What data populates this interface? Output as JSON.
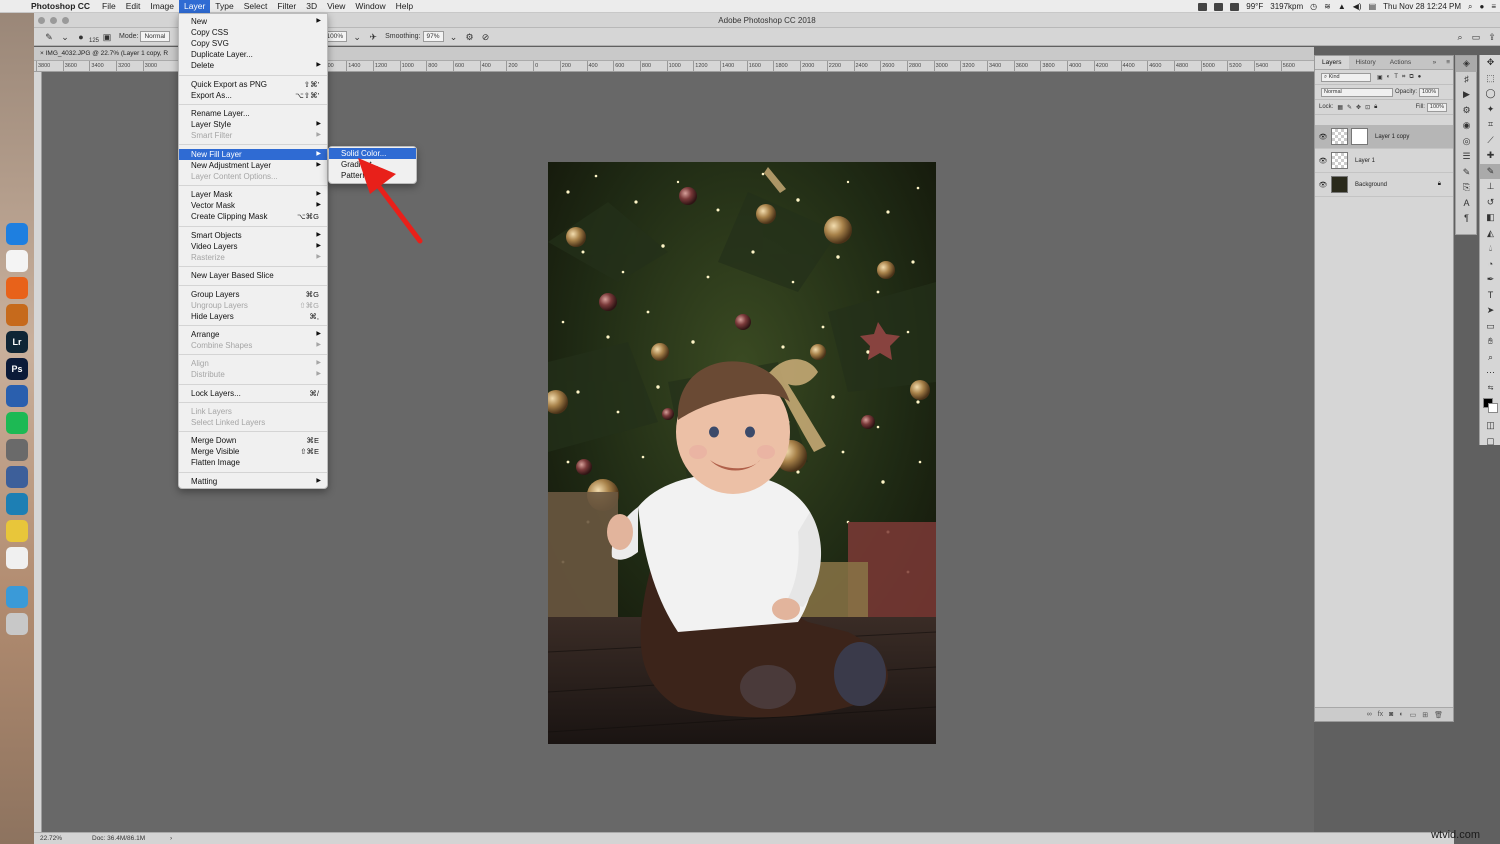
{
  "menubar": {
    "app_name": "Photoshop CC",
    "items": [
      "File",
      "Edit",
      "Image",
      "Layer",
      "Type",
      "Select",
      "Filter",
      "3D",
      "View",
      "Window",
      "Help"
    ],
    "active_item": "Layer",
    "clock": "Thu Nov 28  12:24 PM",
    "temperature": "99°F",
    "network_speed": "3197kpm"
  },
  "window": {
    "title": "Adobe Photoshop CC 2018",
    "doc_tab": "IMG_4032.JPG @ 22.7% (Layer 1 copy, R"
  },
  "options_bar": {
    "brush_size": "125",
    "mode_label": "Mode:",
    "mode_value": "Normal",
    "opacity_value": "100%",
    "smoothing_label": "Smoothing:",
    "smoothing_value": "97%"
  },
  "ruler": {
    "labels": [
      "3800",
      "3600",
      "3400",
      "3200",
      "3000",
      "1600",
      "1400",
      "1200",
      "1000",
      "800",
      "600",
      "400",
      "200",
      "0",
      "200",
      "400",
      "600",
      "800",
      "1000",
      "1200",
      "1400",
      "1600",
      "1800",
      "2000",
      "2200",
      "2400",
      "2600",
      "2800",
      "3000",
      "3200",
      "3400",
      "3600",
      "3800",
      "4000",
      "4200",
      "4400",
      "4600",
      "4800",
      "5000",
      "5200",
      "5400",
      "5600"
    ]
  },
  "layer_menu": {
    "items": [
      {
        "label": "New",
        "shortcut": "",
        "submenu": true,
        "disabled": false
      },
      {
        "label": "Copy CSS",
        "shortcut": "",
        "submenu": false,
        "disabled": false
      },
      {
        "label": "Copy SVG",
        "shortcut": "",
        "submenu": false,
        "disabled": false
      },
      {
        "label": "Duplicate Layer...",
        "shortcut": "",
        "submenu": false,
        "disabled": false
      },
      {
        "label": "Delete",
        "shortcut": "",
        "submenu": true,
        "disabled": false
      },
      {
        "label": "Quick Export as PNG",
        "shortcut": "⇧⌘'",
        "submenu": false,
        "disabled": false
      },
      {
        "label": "Export As...",
        "shortcut": "⌥⇧⌘'",
        "submenu": false,
        "disabled": false
      },
      {
        "label": "Rename Layer...",
        "shortcut": "",
        "submenu": false,
        "disabled": false
      },
      {
        "label": "Layer Style",
        "shortcut": "",
        "submenu": true,
        "disabled": false
      },
      {
        "label": "Smart Filter",
        "shortcut": "",
        "submenu": true,
        "disabled": true
      },
      {
        "label": "New Fill Layer",
        "shortcut": "",
        "submenu": true,
        "disabled": false,
        "highlighted": true
      },
      {
        "label": "New Adjustment Layer",
        "shortcut": "",
        "submenu": true,
        "disabled": false
      },
      {
        "label": "Layer Content Options...",
        "shortcut": "",
        "submenu": false,
        "disabled": true
      },
      {
        "label": "Layer Mask",
        "shortcut": "",
        "submenu": true,
        "disabled": false
      },
      {
        "label": "Vector Mask",
        "shortcut": "",
        "submenu": true,
        "disabled": false
      },
      {
        "label": "Create Clipping Mask",
        "shortcut": "⌥⌘G",
        "submenu": false,
        "disabled": false
      },
      {
        "label": "Smart Objects",
        "shortcut": "",
        "submenu": true,
        "disabled": false
      },
      {
        "label": "Video Layers",
        "shortcut": "",
        "submenu": true,
        "disabled": false
      },
      {
        "label": "Rasterize",
        "shortcut": "",
        "submenu": true,
        "disabled": true
      },
      {
        "label": "New Layer Based Slice",
        "shortcut": "",
        "submenu": false,
        "disabled": false
      },
      {
        "label": "Group Layers",
        "shortcut": "⌘G",
        "submenu": false,
        "disabled": false
      },
      {
        "label": "Ungroup Layers",
        "shortcut": "⇧⌘G",
        "submenu": false,
        "disabled": true
      },
      {
        "label": "Hide Layers",
        "shortcut": "⌘,",
        "submenu": false,
        "disabled": false
      },
      {
        "label": "Arrange",
        "shortcut": "",
        "submenu": true,
        "disabled": false
      },
      {
        "label": "Combine Shapes",
        "shortcut": "",
        "submenu": true,
        "disabled": true
      },
      {
        "label": "Align",
        "shortcut": "",
        "submenu": true,
        "disabled": true
      },
      {
        "label": "Distribute",
        "shortcut": "",
        "submenu": true,
        "disabled": true
      },
      {
        "label": "Lock Layers...",
        "shortcut": "⌘/",
        "submenu": false,
        "disabled": false
      },
      {
        "label": "Link Layers",
        "shortcut": "",
        "submenu": false,
        "disabled": true
      },
      {
        "label": "Select Linked Layers",
        "shortcut": "",
        "submenu": false,
        "disabled": true
      },
      {
        "label": "Merge Down",
        "shortcut": "⌘E",
        "submenu": false,
        "disabled": false
      },
      {
        "label": "Merge Visible",
        "shortcut": "⇧⌘E",
        "submenu": false,
        "disabled": false
      },
      {
        "label": "Flatten Image",
        "shortcut": "",
        "submenu": false,
        "disabled": false
      },
      {
        "label": "Matting",
        "shortcut": "",
        "submenu": true,
        "disabled": false
      }
    ]
  },
  "fill_submenu": {
    "items": [
      {
        "label": "Solid Color...",
        "highlighted": true
      },
      {
        "label": "Gradient...",
        "highlighted": false
      },
      {
        "label": "Pattern...",
        "highlighted": false
      }
    ]
  },
  "layers_panel": {
    "tabs": [
      "Layers",
      "History",
      "Actions"
    ],
    "active_tab": "Layers",
    "filter_kind": "Kind",
    "blend_mode": "Normal",
    "opacity_label": "Opacity:",
    "opacity_value": "100%",
    "lock_label": "Lock:",
    "fill_label": "Fill:",
    "fill_value": "100%",
    "layers": [
      {
        "name": "Layer 1 copy",
        "selected": true,
        "has_mask": true,
        "locked": false
      },
      {
        "name": "Layer 1",
        "selected": false,
        "has_mask": false,
        "locked": false
      },
      {
        "name": "Background",
        "selected": false,
        "has_mask": false,
        "locked": true
      }
    ]
  },
  "status_bar": {
    "zoom": "22.72%",
    "doc_size": "Doc: 36.4M/86.1M"
  },
  "dock": {
    "apps": [
      {
        "label": "",
        "color": "#1e7fe0"
      },
      {
        "label": "",
        "color": "#f4f4f4"
      },
      {
        "label": "",
        "color": "#e8621a"
      },
      {
        "label": "",
        "color": "#c66a1c"
      },
      {
        "label": "Lr",
        "color": "#0f2535"
      },
      {
        "label": "Ps",
        "color": "#0b1a38"
      },
      {
        "label": "",
        "color": "#2a5fae"
      },
      {
        "label": "",
        "color": "#1db954"
      },
      {
        "label": "",
        "color": "#6a6a6a"
      },
      {
        "label": "",
        "color": "#3d5f9a"
      },
      {
        "label": "",
        "color": "#1d7fb4"
      },
      {
        "label": "",
        "color": "#e8c63a"
      },
      {
        "label": "",
        "color": "#f0f0f0"
      },
      {
        "label": "",
        "color": "#3a9ad8"
      },
      {
        "label": "",
        "color": "#c8c8c8"
      }
    ]
  },
  "watermark": "wtvid.com",
  "colors": {
    "menu_highlight": "#2f6bd3",
    "arrow": "#e8201a"
  }
}
